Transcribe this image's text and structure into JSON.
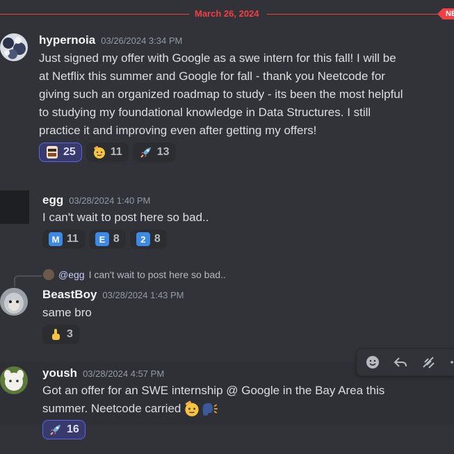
{
  "divider": {
    "date": "March 26, 2024",
    "new_label": "NEW"
  },
  "messages": [
    {
      "author": "hypernoia",
      "timestamp": "03/26/2024 3:34 PM",
      "lines": [
        "Just signed my offer with Google as a swe intern for this fall! I will be",
        "at Netflix this summer and Google for fall - thank you Neetcode for",
        "giving such an organized roadmap to study - its been the most helpful",
        "to studying my foundational knowledge in Data Structures. I still",
        "practice it and improving even after getting my offers!"
      ],
      "reactions": [
        {
          "emoji": "neetcode-emoji",
          "count": "25",
          "selected": true
        },
        {
          "emoji": "saluting-face",
          "count": "11",
          "selected": false
        },
        {
          "emoji": "rocket",
          "count": "13",
          "selected": false
        }
      ]
    },
    {
      "author": "egg",
      "timestamp": "03/28/2024 1:40 PM",
      "text": "I can't wait to post here so bad..",
      "reactions": [
        {
          "emoji": "M",
          "count": "11"
        },
        {
          "emoji": "E",
          "count": "8"
        },
        {
          "emoji": "2",
          "count": "8"
        }
      ]
    },
    {
      "reply_to": {
        "mention": "@egg",
        "text": "I can't wait to post here so bad.."
      },
      "author": "BeastBoy",
      "timestamp": "03/28/2024 1:43 PM",
      "text": "same bro",
      "reactions": [
        {
          "emoji": "point-up",
          "count": "3"
        }
      ]
    },
    {
      "author": "yoush",
      "timestamp": "03/28/2024 4:57 PM",
      "lines": [
        "Got an offer for an SWE internship @ Google in the Bay Area this",
        "summer. Neetcode carried"
      ],
      "reactions": [
        {
          "emoji": "rocket",
          "count": "16",
          "selected": true
        }
      ]
    }
  ],
  "toolbar": [
    "add-reaction",
    "reply",
    "forward",
    "more"
  ],
  "colors": {
    "accent": "#f23f43",
    "selected": "#5865f2",
    "background": "#313338"
  }
}
